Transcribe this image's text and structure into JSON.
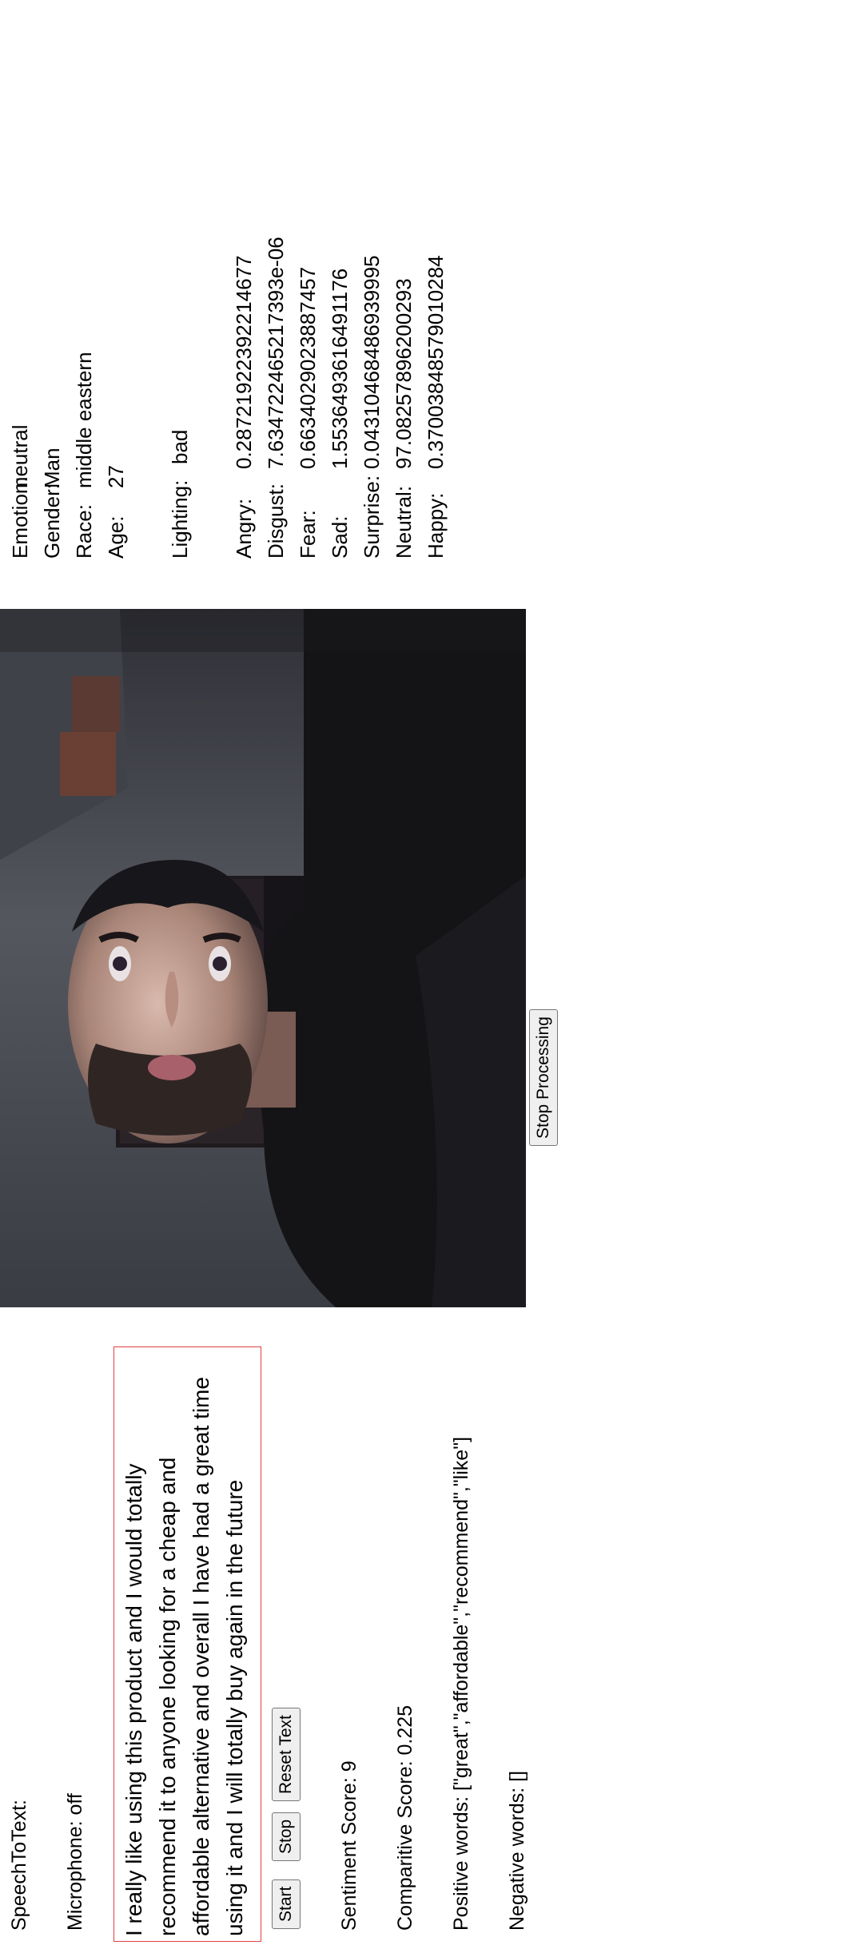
{
  "speech": {
    "title": "SpeechToText:",
    "microphone_status": "Microphone: off",
    "transcript": "I really like using this product and I would totally recommend it to anyone looking for a cheap and affordable alternative and overall I have had a great time using it and I will totally buy again in the future",
    "start_label": "Start",
    "stop_label": "Stop",
    "reset_label": "Reset Text",
    "sentiment_score": "Sentiment Score: 9",
    "comparative_score": "Comparitive Score: 0.225",
    "positive_words": "Positive words: [\"great\",\"affordable\",\"recommend\",\"like\"]",
    "negative_words": "Negative words: []"
  },
  "video": {
    "stop_processing_label": "Stop Processing"
  },
  "analysis": {
    "summary": [
      {
        "key": "Emotion:",
        "value": "neutral"
      },
      {
        "key": "Gender:",
        "value": "Man"
      },
      {
        "key": "Race:",
        "value": "middle eastern"
      },
      {
        "key": "Age:",
        "value": "27"
      }
    ],
    "lighting": {
      "key": "Lighting:",
      "value": "bad"
    },
    "emotions": [
      {
        "key": "Angry:",
        "value": "0.2872192239221467​7"
      },
      {
        "key": "Disgust:",
        "value": "7.634722465217393e-06"
      },
      {
        "key": "Fear:",
        "value": "0.6634029023887457"
      },
      {
        "key": "Sad:",
        "value": "1.5536493616491176"
      },
      {
        "key": "Surprise:",
        "value": "0.04310468486939995"
      },
      {
        "key": "Neutral:",
        "value": "97.08257896200293"
      },
      {
        "key": "Happy:",
        "value": "0.37003848579010284"
      }
    ]
  },
  "colors": {
    "transcript_border": "#e04040",
    "button_bg": "#efefef"
  }
}
